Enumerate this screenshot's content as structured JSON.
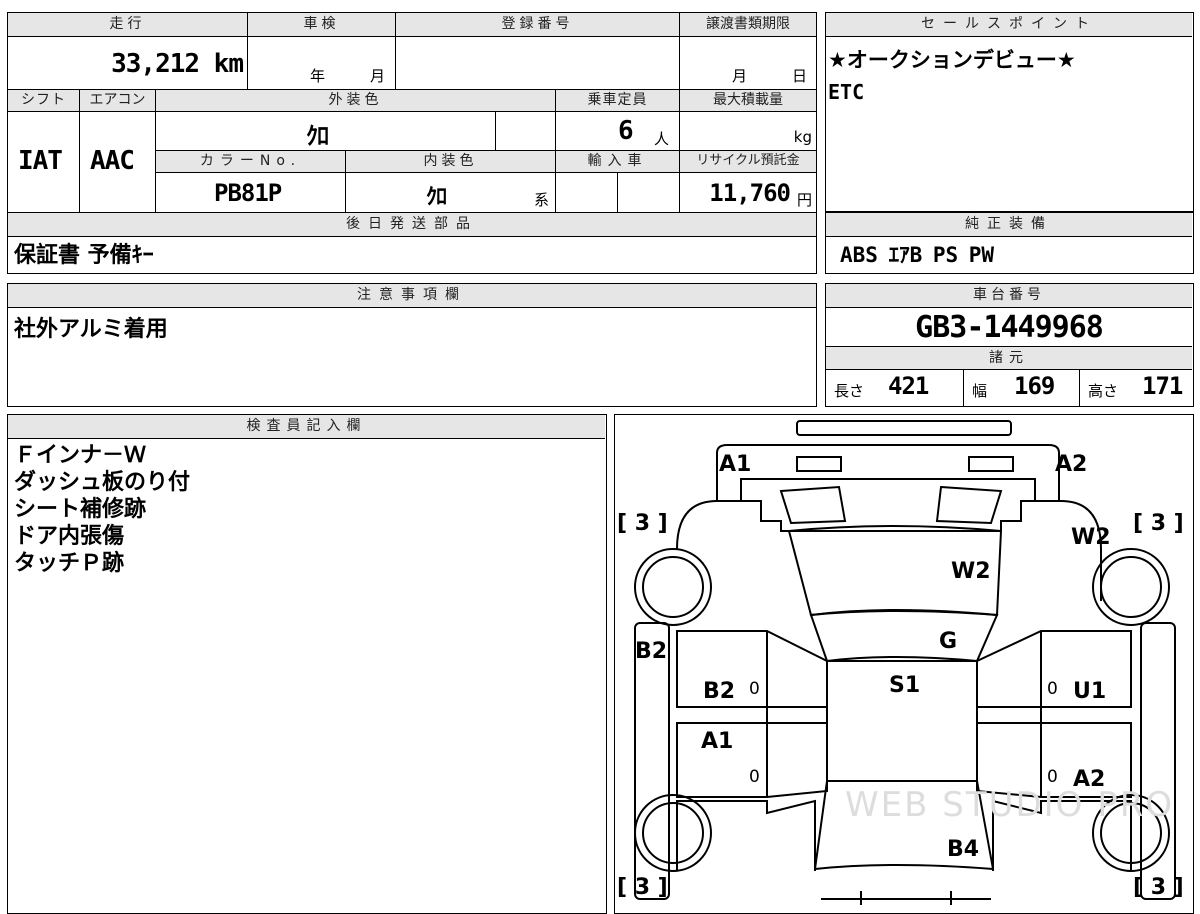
{
  "vehicle": {
    "headers": {
      "mileage": "走行",
      "inspection": "車検",
      "registration_no": "登録番号",
      "transfer_deadline": "譲渡書類期限",
      "shift": "シフト",
      "aircon": "エアコン",
      "exterior_color": "外装色",
      "capacity": "乗車定員",
      "max_load": "最大積載量",
      "color_no": "カラーNo.",
      "interior_color": "内装色",
      "import": "輸入車",
      "recycle_deposit": "リサイクル預託金",
      "later_parts": "後日発送部品"
    },
    "mileage_value": "33,212 km",
    "inspection_year_unit": "年",
    "inspection_month_unit": "月",
    "deadline_month_unit": "月",
    "deadline_day_unit": "日",
    "shift_value": "IAT",
    "aircon_value": "AAC",
    "exterior_color_value": "ｸﾛ",
    "capacity_value": "6",
    "capacity_unit": "人",
    "max_load_unit": "kg",
    "color_no_value": "PB81P",
    "interior_color_value": "ｸﾛ",
    "interior_color_suffix": "系",
    "recycle_value": "11,760",
    "recycle_unit": "円",
    "later_parts_value": "保証書 予備ｷｰ"
  },
  "sales_points": {
    "header": "セールスポイント",
    "line1": "★オークションデビュー★",
    "line2": "ETC"
  },
  "standard_equipment": {
    "header": "純正装備",
    "value": "ABS ｴｱB PS PW"
  },
  "notes": {
    "header": "注意事項欄",
    "value": "社外アルミ着用"
  },
  "chassis": {
    "header": "車台番号",
    "value": "GB3-1449968",
    "spec_header": "諸元",
    "length_label": "長さ",
    "length_value": "421",
    "width_label": "幅",
    "width_value": "169",
    "height_label": "高さ",
    "height_value": "171"
  },
  "inspector": {
    "header": "検査員記入欄",
    "lines": [
      "Ｆインナ－Ｗ",
      "ダッシュ板のり付",
      "シート補修跡",
      "ドア内張傷",
      "タッチＰ跡"
    ]
  },
  "diagram": {
    "labels": {
      "front_left": "A1",
      "front_right": "A2",
      "right_fender": "W2",
      "windshield": "W2",
      "hood": "G",
      "roof": "S1",
      "left_pillar": "B2",
      "left_front_door": "B2",
      "left_rear_door": "A1",
      "right_front_door": "U1",
      "right_rear_door": "A2",
      "rear": "B4",
      "left_front_door_zero": "0",
      "left_rear_door_zero": "0",
      "right_front_door_zero": "0",
      "right_rear_door_zero": "0"
    },
    "tire_tl": "[ 3 ]",
    "tire_tr": "[ 3 ]",
    "tire_bl": "[ 3 ]",
    "tire_br": "[ 3 ]",
    "watermark": "WEB STUDIO PRO"
  }
}
